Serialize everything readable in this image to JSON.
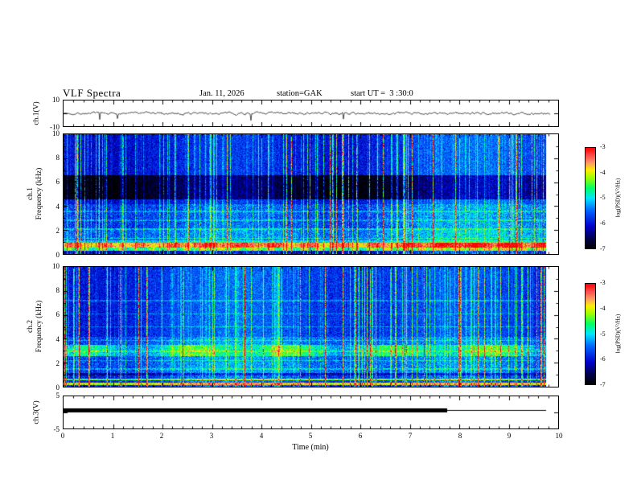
{
  "header": {
    "title": "VLF Spectra",
    "date": "Jan. 11, 2026",
    "station": "station=GAK",
    "start_ut": "start UT =  3 :30:0"
  },
  "panels": {
    "ch1_wave": {
      "label": "ch.1(V)",
      "yticks": [
        "10",
        "-10"
      ]
    },
    "ch1_spec": {
      "channel": "ch.1",
      "axis": "Frequency (kHz)",
      "yticks": [
        "10",
        "8",
        "6",
        "4",
        "2",
        "0"
      ]
    },
    "ch2_spec": {
      "channel": "ch.2",
      "axis": "Frequency (kHz)",
      "yticks": [
        "10",
        "8",
        "6",
        "4",
        "2",
        "0"
      ]
    },
    "ch3_wave": {
      "label": "ch.3(V)",
      "yticks": [
        "5",
        "-5"
      ]
    }
  },
  "xaxis": {
    "label": "Time (min)",
    "ticks": [
      "0",
      "1",
      "2",
      "3",
      "4",
      "5",
      "6",
      "7",
      "8",
      "9",
      "10"
    ]
  },
  "colorbar": {
    "label": "log(PSD)(V²/Hz)",
    "ticks": [
      "-3",
      "-4",
      "-5",
      "-6",
      "-7"
    ],
    "gradient": [
      {
        "pos": 0.0,
        "color": "#000000"
      },
      {
        "pos": 0.1,
        "color": "#00004d"
      },
      {
        "pos": 0.22,
        "color": "#0000cc"
      },
      {
        "pos": 0.38,
        "color": "#0066ff"
      },
      {
        "pos": 0.5,
        "color": "#00e6ff"
      },
      {
        "pos": 0.6,
        "color": "#00ff66"
      },
      {
        "pos": 0.7,
        "color": "#99ff00"
      },
      {
        "pos": 0.78,
        "color": "#ffee00"
      },
      {
        "pos": 0.85,
        "color": "#ff9966"
      },
      {
        "pos": 0.92,
        "color": "#ff5050"
      },
      {
        "pos": 1.0,
        "color": "#ff0000"
      }
    ]
  },
  "chart_data": [
    {
      "type": "line",
      "title": "ch.1 waveform",
      "xlabel": "Time (min)",
      "ylabel": "ch.1(V)",
      "xlim": [
        0,
        10
      ],
      "ylim": [
        -10,
        10
      ],
      "description": "Black noise trace centered on 0 V, fluctuations about ±1.5 V with sparse impulsive spikes over the full 10 min record"
    },
    {
      "type": "heatmap",
      "title": "ch.1 VLF spectrogram",
      "xlabel": "Time (min)",
      "ylabel": "Frequency (kHz)",
      "xlim": [
        0,
        10
      ],
      "ylim": [
        0,
        10
      ],
      "zlabel": "log(PSD)(V²/Hz)",
      "zlim": [
        -7,
        -3
      ],
      "features": [
        "continuous intense yellow-red band near 0.5-1.0 kHz (log PSD ~ -3.5)",
        "dense vertical broadband sferic streaks from green to red across all frequencies",
        "dark quiet band near 4.6-6.6 kHz (log PSD ~ -7) with slow blob-like modulation",
        "blue background ~ -6.3 with cyan speckle below 4 kHz",
        "faint horizontal cyan lines near 1.4, 2.1, 2.9 and 3.6 kHz",
        "record ends near 9.8 min, white gap before right axis"
      ]
    },
    {
      "type": "heatmap",
      "title": "ch.2 VLF spectrogram",
      "xlabel": "Time (min)",
      "ylabel": "Frequency (kHz)",
      "xlim": [
        0,
        10
      ],
      "ylim": [
        0,
        10
      ],
      "zlabel": "log(PSD)(V²/Hz)",
      "zlim": [
        -7,
        -3
      ],
      "features": [
        "bright narrowband green lines near 0.3 and 0.6 kHz",
        "dark row near 1 kHz",
        "diffuse green-cyan band near 2.6-3.5 kHz",
        "dense vertical sferic streaks green to red",
        "blue background ~ -6.3 with cyan speckle below 4 kHz",
        "record ends near 9.8 min"
      ]
    },
    {
      "type": "line",
      "title": "ch.3 telemetry",
      "xlabel": "Time (min)",
      "ylabel": "ch.3(V)",
      "xlim": [
        0,
        10
      ],
      "ylim": [
        -5,
        5
      ],
      "description": "Dense black square-wave band near +1 V from 0 to ~7.7 min, then a flat thin line at the same level until ~9.8 min"
    }
  ]
}
